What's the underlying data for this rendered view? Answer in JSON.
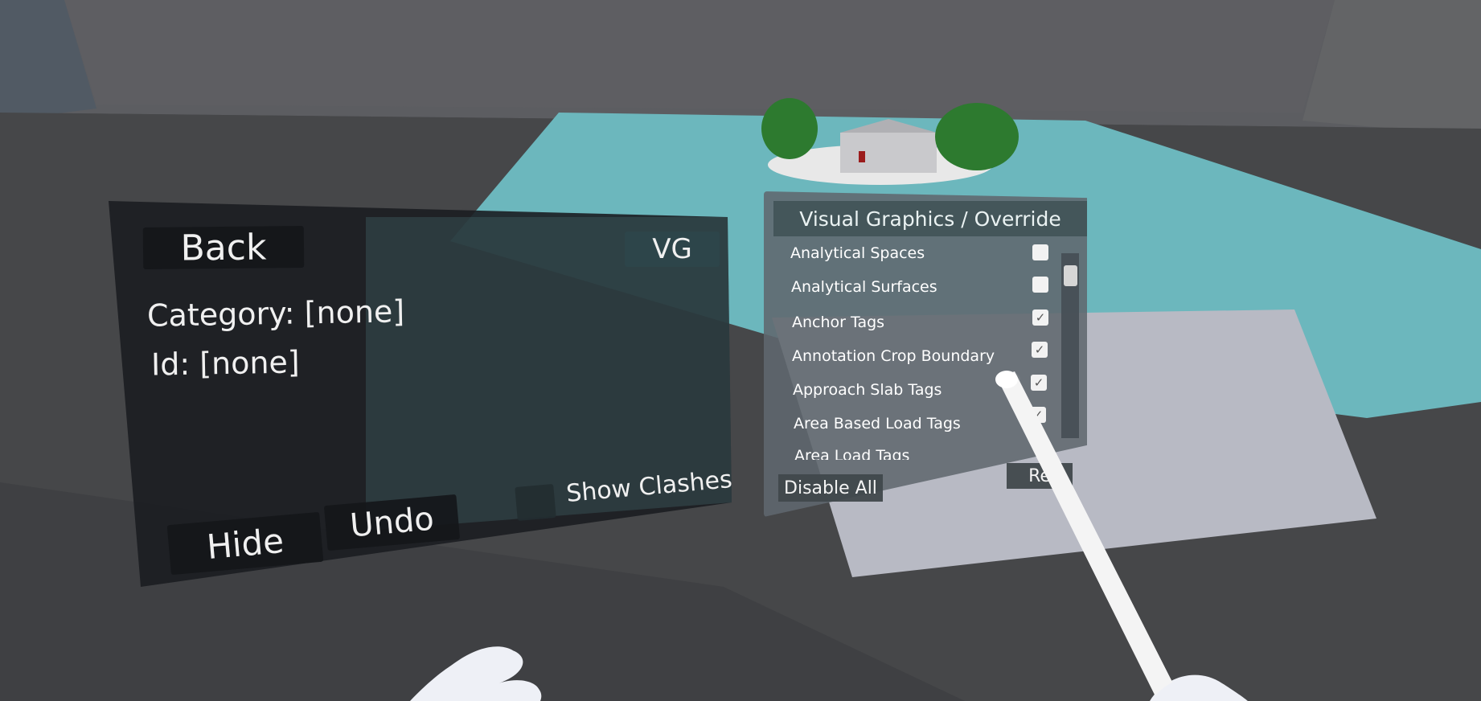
{
  "left_panel": {
    "back_label": "Back",
    "vg_label": "VG",
    "category_text": "Category: [none]",
    "id_text": "Id: [none]",
    "hide_label": "Hide",
    "undo_label": "Undo",
    "show_clashes_label": "Show Clashes"
  },
  "right_panel": {
    "title": "Visual Graphics / Override",
    "items": [
      {
        "label": "Analytical Spaces",
        "checked": false
      },
      {
        "label": "Analytical Surfaces",
        "checked": false
      },
      {
        "label": "Anchor Tags",
        "checked": true
      },
      {
        "label": "Annotation Crop Boundary",
        "checked": true
      },
      {
        "label": "Approach Slab Tags",
        "checked": true
      },
      {
        "label": "Area Based Load Tags",
        "checked": true
      },
      {
        "label": "Area Load Tags",
        "checked": false
      }
    ],
    "disable_all_label": "Disable All",
    "reset_label": "Re"
  },
  "colors": {
    "water": "#6cb7bd",
    "platform": "#b8bac4",
    "trees": "#2d7a2f"
  }
}
